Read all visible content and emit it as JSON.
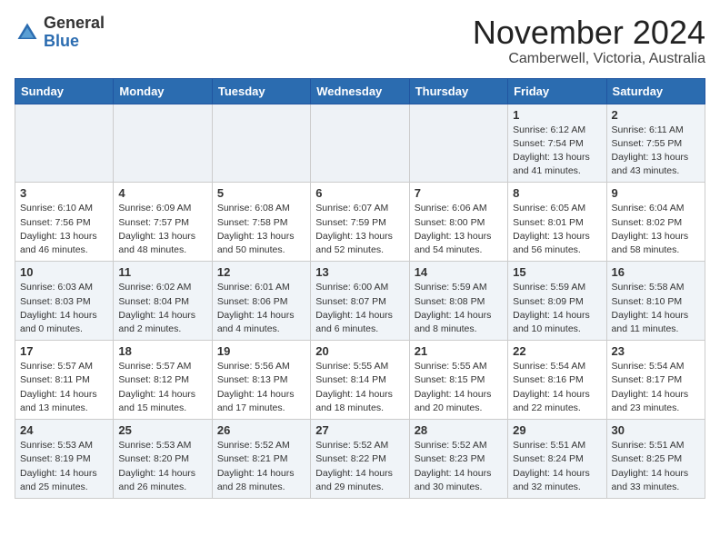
{
  "header": {
    "logo_general": "General",
    "logo_blue": "Blue",
    "month_title": "November 2024",
    "location": "Camberwell, Victoria, Australia"
  },
  "calendar": {
    "days_of_week": [
      "Sunday",
      "Monday",
      "Tuesday",
      "Wednesday",
      "Thursday",
      "Friday",
      "Saturday"
    ],
    "weeks": [
      [
        {
          "day": "",
          "info": ""
        },
        {
          "day": "",
          "info": ""
        },
        {
          "day": "",
          "info": ""
        },
        {
          "day": "",
          "info": ""
        },
        {
          "day": "",
          "info": ""
        },
        {
          "day": "1",
          "info": "Sunrise: 6:12 AM\nSunset: 7:54 PM\nDaylight: 13 hours\nand 41 minutes."
        },
        {
          "day": "2",
          "info": "Sunrise: 6:11 AM\nSunset: 7:55 PM\nDaylight: 13 hours\nand 43 minutes."
        }
      ],
      [
        {
          "day": "3",
          "info": "Sunrise: 6:10 AM\nSunset: 7:56 PM\nDaylight: 13 hours\nand 46 minutes."
        },
        {
          "day": "4",
          "info": "Sunrise: 6:09 AM\nSunset: 7:57 PM\nDaylight: 13 hours\nand 48 minutes."
        },
        {
          "day": "5",
          "info": "Sunrise: 6:08 AM\nSunset: 7:58 PM\nDaylight: 13 hours\nand 50 minutes."
        },
        {
          "day": "6",
          "info": "Sunrise: 6:07 AM\nSunset: 7:59 PM\nDaylight: 13 hours\nand 52 minutes."
        },
        {
          "day": "7",
          "info": "Sunrise: 6:06 AM\nSunset: 8:00 PM\nDaylight: 13 hours\nand 54 minutes."
        },
        {
          "day": "8",
          "info": "Sunrise: 6:05 AM\nSunset: 8:01 PM\nDaylight: 13 hours\nand 56 minutes."
        },
        {
          "day": "9",
          "info": "Sunrise: 6:04 AM\nSunset: 8:02 PM\nDaylight: 13 hours\nand 58 minutes."
        }
      ],
      [
        {
          "day": "10",
          "info": "Sunrise: 6:03 AM\nSunset: 8:03 PM\nDaylight: 14 hours\nand 0 minutes."
        },
        {
          "day": "11",
          "info": "Sunrise: 6:02 AM\nSunset: 8:04 PM\nDaylight: 14 hours\nand 2 minutes."
        },
        {
          "day": "12",
          "info": "Sunrise: 6:01 AM\nSunset: 8:06 PM\nDaylight: 14 hours\nand 4 minutes."
        },
        {
          "day": "13",
          "info": "Sunrise: 6:00 AM\nSunset: 8:07 PM\nDaylight: 14 hours\nand 6 minutes."
        },
        {
          "day": "14",
          "info": "Sunrise: 5:59 AM\nSunset: 8:08 PM\nDaylight: 14 hours\nand 8 minutes."
        },
        {
          "day": "15",
          "info": "Sunrise: 5:59 AM\nSunset: 8:09 PM\nDaylight: 14 hours\nand 10 minutes."
        },
        {
          "day": "16",
          "info": "Sunrise: 5:58 AM\nSunset: 8:10 PM\nDaylight: 14 hours\nand 11 minutes."
        }
      ],
      [
        {
          "day": "17",
          "info": "Sunrise: 5:57 AM\nSunset: 8:11 PM\nDaylight: 14 hours\nand 13 minutes."
        },
        {
          "day": "18",
          "info": "Sunrise: 5:57 AM\nSunset: 8:12 PM\nDaylight: 14 hours\nand 15 minutes."
        },
        {
          "day": "19",
          "info": "Sunrise: 5:56 AM\nSunset: 8:13 PM\nDaylight: 14 hours\nand 17 minutes."
        },
        {
          "day": "20",
          "info": "Sunrise: 5:55 AM\nSunset: 8:14 PM\nDaylight: 14 hours\nand 18 minutes."
        },
        {
          "day": "21",
          "info": "Sunrise: 5:55 AM\nSunset: 8:15 PM\nDaylight: 14 hours\nand 20 minutes."
        },
        {
          "day": "22",
          "info": "Sunrise: 5:54 AM\nSunset: 8:16 PM\nDaylight: 14 hours\nand 22 minutes."
        },
        {
          "day": "23",
          "info": "Sunrise: 5:54 AM\nSunset: 8:17 PM\nDaylight: 14 hours\nand 23 minutes."
        }
      ],
      [
        {
          "day": "24",
          "info": "Sunrise: 5:53 AM\nSunset: 8:19 PM\nDaylight: 14 hours\nand 25 minutes."
        },
        {
          "day": "25",
          "info": "Sunrise: 5:53 AM\nSunset: 8:20 PM\nDaylight: 14 hours\nand 26 minutes."
        },
        {
          "day": "26",
          "info": "Sunrise: 5:52 AM\nSunset: 8:21 PM\nDaylight: 14 hours\nand 28 minutes."
        },
        {
          "day": "27",
          "info": "Sunrise: 5:52 AM\nSunset: 8:22 PM\nDaylight: 14 hours\nand 29 minutes."
        },
        {
          "day": "28",
          "info": "Sunrise: 5:52 AM\nSunset: 8:23 PM\nDaylight: 14 hours\nand 30 minutes."
        },
        {
          "day": "29",
          "info": "Sunrise: 5:51 AM\nSunset: 8:24 PM\nDaylight: 14 hours\nand 32 minutes."
        },
        {
          "day": "30",
          "info": "Sunrise: 5:51 AM\nSunset: 8:25 PM\nDaylight: 14 hours\nand 33 minutes."
        }
      ]
    ]
  }
}
